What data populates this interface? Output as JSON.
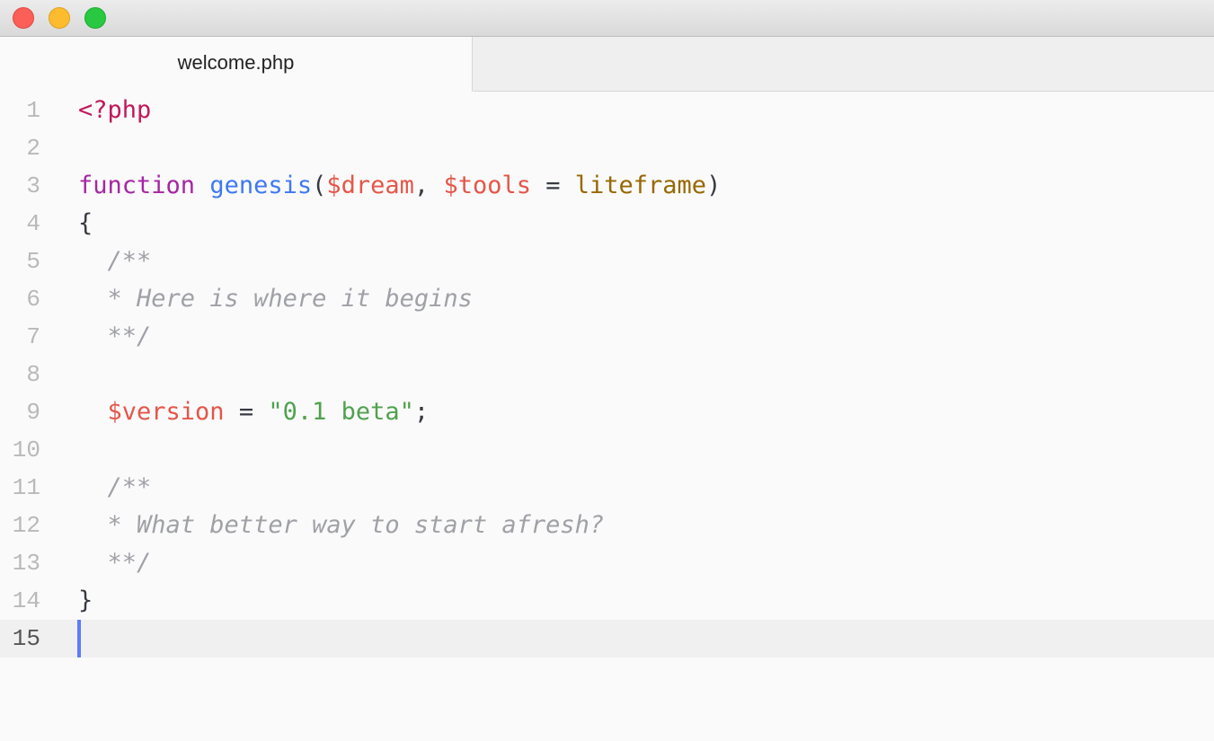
{
  "window": {
    "traffic_lights": {
      "close": "#fc5f57",
      "minimize": "#fdbc2e",
      "zoom": "#28c840"
    }
  },
  "tab": {
    "filename": "welcome.php"
  },
  "editor": {
    "current_line": 15,
    "line_numbers": [
      "1",
      "2",
      "3",
      "4",
      "5",
      "6",
      "7",
      "8",
      "9",
      "10",
      "11",
      "12",
      "13",
      "14",
      "15"
    ],
    "lines": {
      "l1": {
        "open_tag": "<?php"
      },
      "l3": {
        "keyword": "function",
        "space1": " ",
        "fn_name": "genesis",
        "paren_open": "(",
        "param1": "$dream",
        "comma": ", ",
        "param2": "$tools",
        "assign": " = ",
        "default": "liteframe",
        "paren_close": ")"
      },
      "l4": {
        "brace": "{"
      },
      "l5": {
        "comment": "  /**"
      },
      "l6": {
        "comment": "  * Here is where it begins"
      },
      "l7": {
        "comment": "  **/"
      },
      "l9": {
        "indent": "  ",
        "var": "$version",
        "assign": " = ",
        "string": "\"0.1 beta\"",
        "semi": ";"
      },
      "l11": {
        "comment": "  /**"
      },
      "l12": {
        "comment": "  * What better way to start afresh?"
      },
      "l13": {
        "comment": "  **/"
      },
      "l14": {
        "brace": "}"
      }
    },
    "colors": {
      "tag": "#c2185b",
      "keyword": "#a626a4",
      "function": "#4078f2",
      "variable": "#e45649",
      "constant": "#986801",
      "string": "#50a14f",
      "comment": "#a0a1a7",
      "cursor": "#5c7cfa"
    }
  }
}
